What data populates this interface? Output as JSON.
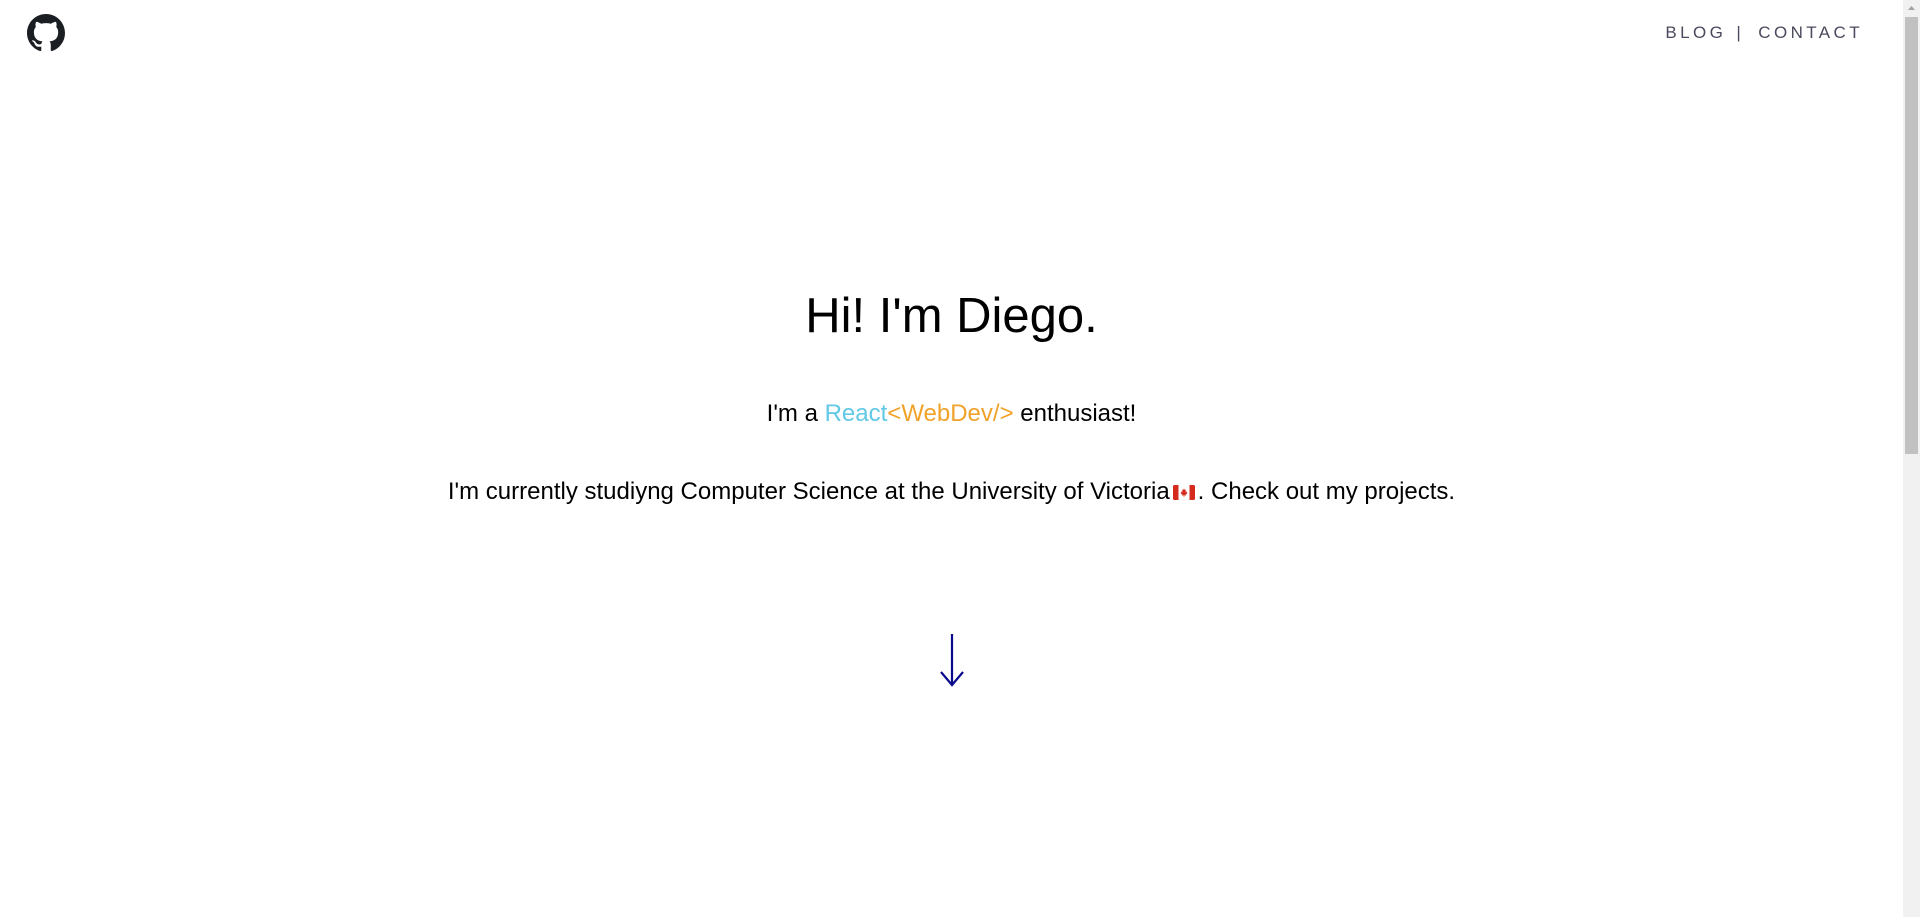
{
  "header": {
    "github_icon": "github-icon",
    "nav": {
      "blog": "BLOG",
      "separator": "|",
      "contact": "CONTACT"
    }
  },
  "hero": {
    "title": "Hi! I'm Diego.",
    "tagline": {
      "prefix": "I'm a ",
      "react": "React",
      "webdev": "<WebDev/>",
      "suffix": " enthusiast!"
    },
    "bio": {
      "text": "I'm currently studiyng Computer Science at the University of Victoria",
      "flag_icon": "canada-flag-icon",
      "suffix": ". Check out my projects."
    },
    "scroll_icon": "down-arrow-icon"
  },
  "colors": {
    "react": "#61c8e6",
    "webdev": "#f0a22a",
    "nav_text": "#4a4a5e",
    "arrow": "#0a0a8c"
  }
}
